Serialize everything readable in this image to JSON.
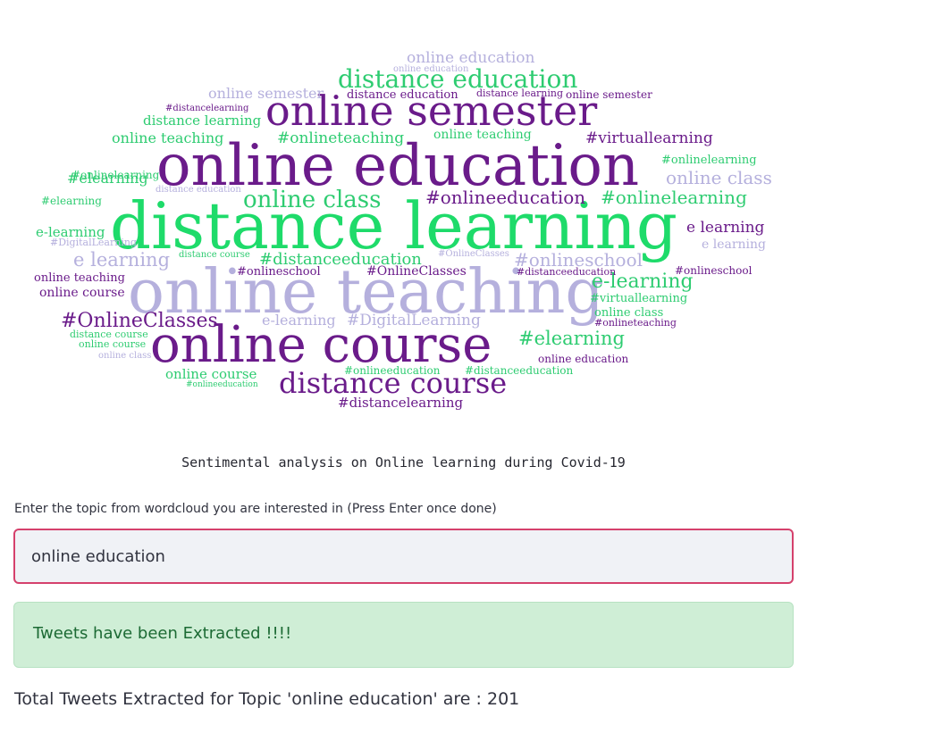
{
  "wordcloud": {
    "words": [
      {
        "text": "online education",
        "color": "#6a1b8a"
      },
      {
        "text": "distance learning",
        "color": "#1edb6a"
      },
      {
        "text": "online teaching",
        "color": "#b5b0dd"
      },
      {
        "text": "online course",
        "color": "#6a1b8a"
      },
      {
        "text": "online semester",
        "color": "#6a1b8a"
      },
      {
        "text": "distance education",
        "color": "#2ecc71"
      },
      {
        "text": "distance course",
        "color": "#6a1b8a"
      },
      {
        "text": "online class",
        "color": "#2ecc71"
      },
      {
        "text": "#onlineeducation",
        "color": "#6a1b8a"
      },
      {
        "text": "#onlinelearning",
        "color": "#2ecc71"
      },
      {
        "text": "#onlineschool",
        "color": "#b5b0dd"
      },
      {
        "text": "e-learning",
        "color": "#2ecc71"
      },
      {
        "text": "#elearning",
        "color": "#2ecc71"
      },
      {
        "text": "#OnlineClasses",
        "color": "#6a1b8a"
      },
      {
        "text": "e learning",
        "color": "#b5b0dd"
      },
      {
        "text": "#distanceeducation",
        "color": "#2ecc71"
      },
      {
        "text": "#virtuallearning",
        "color": "#6a1b8a"
      },
      {
        "text": "#onlineteaching",
        "color": "#2ecc71"
      },
      {
        "text": "distance learning",
        "color": "#2ecc71"
      },
      {
        "text": "online teaching",
        "color": "#2ecc71"
      },
      {
        "text": "online education",
        "color": "#b5b0dd"
      },
      {
        "text": "online semester",
        "color": "#b5b0dd"
      },
      {
        "text": "distance education",
        "color": "#6a1b8a"
      },
      {
        "text": "#distancelearning",
        "color": "#6a1b8a"
      },
      {
        "text": "online class",
        "color": "#b5b0dd"
      },
      {
        "text": "#onlinelearning",
        "color": "#2ecc71"
      },
      {
        "text": "e learning",
        "color": "#6a1b8a"
      },
      {
        "text": "#elearning",
        "color": "#2ecc71"
      },
      {
        "text": "e-learning",
        "color": "#2ecc71"
      },
      {
        "text": "online teaching",
        "color": "#6a1b8a"
      },
      {
        "text": "online course",
        "color": "#6a1b8a"
      },
      {
        "text": "#onlineschool",
        "color": "#6a1b8a"
      },
      {
        "text": "#OnlineClasses",
        "color": "#6a1b8a"
      },
      {
        "text": "e-learning",
        "color": "#b5b0dd"
      },
      {
        "text": "#DigitalLearning",
        "color": "#b5b0dd"
      },
      {
        "text": "online class",
        "color": "#2ecc71"
      },
      {
        "text": "#virtuallearning",
        "color": "#2ecc71"
      },
      {
        "text": "online course",
        "color": "#2ecc71"
      },
      {
        "text": "online education",
        "color": "#6a1b8a"
      },
      {
        "text": "#onlineeducation",
        "color": "#2ecc71"
      },
      {
        "text": "#distanceeducation",
        "color": "#2ecc71"
      },
      {
        "text": "#onlineschool",
        "color": "#6a1b8a"
      },
      {
        "text": "#distanceeducation",
        "color": "#6a1b8a"
      },
      {
        "text": "#onlineteaching",
        "color": "#6a1b8a"
      },
      {
        "text": "distance course",
        "color": "#2ecc71"
      },
      {
        "text": "online education",
        "color": "#b5b0dd"
      },
      {
        "text": "distance learning",
        "color": "#6a1b8a"
      },
      {
        "text": "#DigitalLearning",
        "color": "#b5b0dd"
      },
      {
        "text": "online course",
        "color": "#2ecc71"
      },
      {
        "text": "distance course",
        "color": "#2ecc71"
      },
      {
        "text": "online teaching",
        "color": "#2ecc71"
      },
      {
        "text": "#elearning",
        "color": "#2ecc71"
      },
      {
        "text": "distance education",
        "color": "#b5b0dd"
      },
      {
        "text": "online class",
        "color": "#b5b0dd"
      },
      {
        "text": "#onlineeducation",
        "color": "#2ecc71"
      },
      {
        "text": "e learning",
        "color": "#b5b0dd"
      },
      {
        "text": "#distancelearning",
        "color": "#6a1b8a"
      },
      {
        "text": "#onlinelearning",
        "color": "#2ecc71"
      },
      {
        "text": "online semester",
        "color": "#6a1b8a"
      },
      {
        "text": "#OnlineClasses",
        "color": "#b5b0dd"
      }
    ]
  },
  "caption": "Sentimental analysis on Online learning during Covid-19",
  "topic_input": {
    "label": "Enter the topic from wordcloud you are interested in (Press Enter once done)",
    "value": "online education"
  },
  "status_message": "Tweets have been Extracted !!!!",
  "total_text": "Total Tweets Extracted for Topic 'online education' are : 201"
}
